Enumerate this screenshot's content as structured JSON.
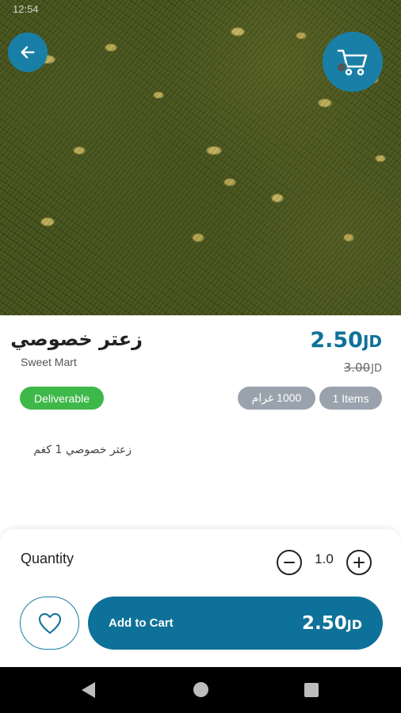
{
  "status_bar": {
    "time": "12:54"
  },
  "product": {
    "title": "زعتر خصوصي",
    "store": "Sweet Mart",
    "price": "2.50",
    "currency": "JD",
    "old_price": "3.00",
    "old_currency": "JD",
    "description": "زعتر خصوصي 1 كغم"
  },
  "badges": {
    "deliverable": "Deliverable",
    "weight": "1000 غرام",
    "items": "1 Items"
  },
  "quantity": {
    "label": "Quantity",
    "value": "1.0",
    "minus": "−",
    "plus": "+"
  },
  "actions": {
    "add_to_cart_label": "Add to Cart",
    "add_to_cart_price": "2.50",
    "add_to_cart_currency": "JD"
  },
  "icons": {
    "back": "back-arrow-icon",
    "cart": "cart-icon",
    "favorite": "heart-icon"
  },
  "colors": {
    "accent": "#0e7199",
    "button_circle": "#1a7fa6",
    "deliverable": "#3fb84a",
    "pill_grey": "#9aa3ad"
  }
}
